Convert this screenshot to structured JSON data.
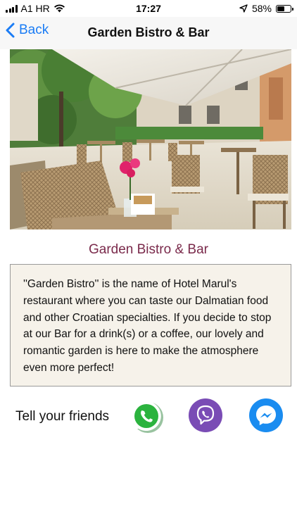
{
  "status_bar": {
    "carrier": "A1 HR",
    "time": "17:27",
    "battery_percent": "58%",
    "battery_level": 0.58,
    "icons": [
      "signal-icon",
      "wifi-icon",
      "location-arrow-icon",
      "battery-icon"
    ]
  },
  "nav": {
    "back_label": "Back",
    "title": "Garden Bistro & Bar",
    "accent_color": "#1a7cf5"
  },
  "content": {
    "section_title": "Garden Bistro & Bar",
    "title_color": "#7a2a4b",
    "description": "''Garden Bistro'' is the name of Hotel Marul's restaurant where you can taste our Dalmatian food and other Croatian specialties. If you decide to stop at our Bar for a drink(s) or a coffee, our lovely and romantic garden is here to make the atmosphere even more perfect!"
  },
  "share": {
    "label": "Tell your friends",
    "buttons": [
      {
        "icon": "whatsapp-icon",
        "color": "#25b43c"
      },
      {
        "icon": "viber-icon",
        "color": "#7a4cb5"
      },
      {
        "icon": "messenger-icon",
        "color": "#1a8cf0"
      }
    ]
  }
}
